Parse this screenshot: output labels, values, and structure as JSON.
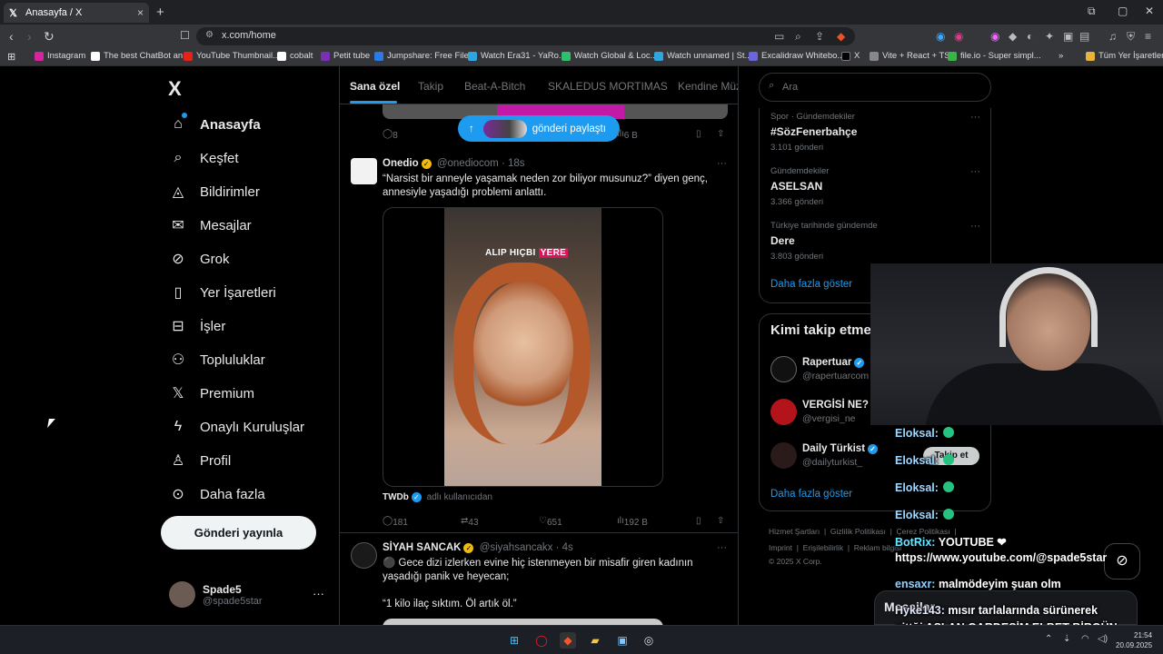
{
  "browser": {
    "tab_title": "Anasayfa / X",
    "tab_close": "×",
    "new_tab": "+",
    "url": "x.com/home",
    "bookmarks": [
      {
        "label": "Instagram",
        "color": "#d6249f"
      },
      {
        "label": "The best ChatBot an...",
        "color": "#ffffff"
      },
      {
        "label": "YouTube Thumbnail...",
        "color": "#e62117"
      },
      {
        "label": "cobalt",
        "color": "#ffffff"
      },
      {
        "label": "Petit tube",
        "color": "#7b2fb5"
      },
      {
        "label": "Jumpshare: Free File...",
        "color": "#2c7be5"
      },
      {
        "label": "Watch Era31 - YaRo...",
        "color": "#2ea7e0"
      },
      {
        "label": "Watch Global & Loc...",
        "color": "#30c06b"
      },
      {
        "label": "Watch unnamed | St...",
        "color": "#2ea7e0"
      },
      {
        "label": "Excalidraw Whitebo...",
        "color": "#6965db"
      },
      {
        "label": "X",
        "color": "#000000"
      },
      {
        "label": "Vite + React + TS",
        "color": "#888888"
      },
      {
        "label": "file.io - Super simpl...",
        "color": "#3bb54a"
      }
    ],
    "all_bookmarks": "Tüm Yer İşaretleri"
  },
  "sidebar": {
    "logo": "X",
    "items": [
      {
        "label": "Anasayfa",
        "icon": "home-icon"
      },
      {
        "label": "Keşfet",
        "icon": "search-icon"
      },
      {
        "label": "Bildirimler",
        "icon": "bell-icon"
      },
      {
        "label": "Mesajlar",
        "icon": "mail-icon"
      },
      {
        "label": "Grok",
        "icon": "grok-icon"
      },
      {
        "label": "Yer İşaretleri",
        "icon": "bookmark-icon"
      },
      {
        "label": "İşler",
        "icon": "briefcase-icon"
      },
      {
        "label": "Topluluklar",
        "icon": "people-icon"
      },
      {
        "label": "Premium",
        "icon": "x-icon"
      },
      {
        "label": "Onaylı Kuruluşlar",
        "icon": "lightning-icon"
      },
      {
        "label": "Profil",
        "icon": "person-icon"
      },
      {
        "label": "Daha fazla",
        "icon": "more-circle-icon"
      }
    ],
    "post_button": "Gönderi yayınla",
    "account": {
      "name": "Spade5",
      "handle": "@spade5star",
      "more": "···"
    }
  },
  "feed": {
    "tabs": [
      "Sana özel",
      "Takip",
      "Beat-A-Bitch",
      "SKALEDUS MORTIMAS",
      "Kendine Müz"
    ],
    "share_pill": "gönderi paylaştı",
    "share_pill_arrow": "↑",
    "top_post_actions": {
      "replies": "8",
      "views": "6 B"
    },
    "posts": [
      {
        "name": "Onedio",
        "handle": "@onediocom",
        "time": "· 18s",
        "text": "“Narsist bir anneyle yaşamak neden zor biliyor musunuz?” diyen genç, annesiyle yaşadığı problemi anlattı.",
        "video_caption_1": "ALIP HIÇBI",
        "video_caption_2": "YERE",
        "source_name": "TWDb",
        "source_rest": "adlı kullanıcıdan",
        "replies": "181",
        "reposts": "43",
        "likes": "651",
        "views": "192 B"
      },
      {
        "name": "SİYAH SANCAK",
        "handle": "@siyahsancakx",
        "time": "· 4s",
        "text": "Gece dizi izlerken evine hiç istenmeyen bir misafir giren kadının yaşadığı panik ve heyecan;",
        "quote": "“1 kilo ilaç sıktım. Öl artık öl.”"
      }
    ]
  },
  "right": {
    "search_placeholder": "Ara",
    "trends": [
      {
        "category": "Spor · Gündemdekiler",
        "name": "#SözFenerbahçe",
        "count": "3.101 gönderi"
      },
      {
        "category": "Gündemdekiler",
        "name": "ASELSAN",
        "count": "3.366 gönderi"
      },
      {
        "category": "Türkiye tarihinde gündemde",
        "name": "Dere",
        "count": "3.803 gönderi"
      }
    ],
    "show_more": "Daha fazla göster",
    "who_to_follow_title": "Kimi takip etmeli",
    "who_to_follow": [
      {
        "name": "Rapertuar",
        "handle": "@rapertuarcom",
        "color": "#111111"
      },
      {
        "name": "VERGİSİ NE?",
        "handle": "@vergisi_ne",
        "color": "#b3131b"
      },
      {
        "name": "Daily Türkist",
        "handle": "@dailyturkist_",
        "color": "#2a1a1a"
      }
    ],
    "follow_button": "Takip et",
    "footer_row1": [
      "Hizmet Şartları",
      "|",
      "Gizlilik Politikası",
      "|",
      "Çerez Politikası",
      "|"
    ],
    "footer_row2": [
      "Imprint",
      "|",
      "Erişilebilirlik",
      "|",
      "Reklam bilgisi"
    ],
    "copyright": "© 2025 X Corp.",
    "messages_dock": "Mesajlar"
  },
  "chat": [
    {
      "user": "Eloksal:",
      "text": ""
    },
    {
      "user": "Eloksal:",
      "text": ""
    },
    {
      "user": "Eloksal:",
      "text": ""
    },
    {
      "user": "Eloksal:",
      "text": ""
    },
    {
      "user": "BotRix:",
      "text": "YOUTUBE ❤"
    },
    {
      "user": "",
      "text": "https://www.youtube.com/@spade5star"
    },
    {
      "user": "ensaxr:",
      "text": "malmödeyim şuan olm"
    },
    {
      "user": "Hyke143:",
      "text": "mısır tarlalarında sürünerek"
    },
    {
      "user": "",
      "text": "gittği ASLAN GARDEŞİM ELBET BİRGÜN"
    }
  ],
  "taskbar": {
    "time": "21:54",
    "date": "20.09.2025"
  }
}
